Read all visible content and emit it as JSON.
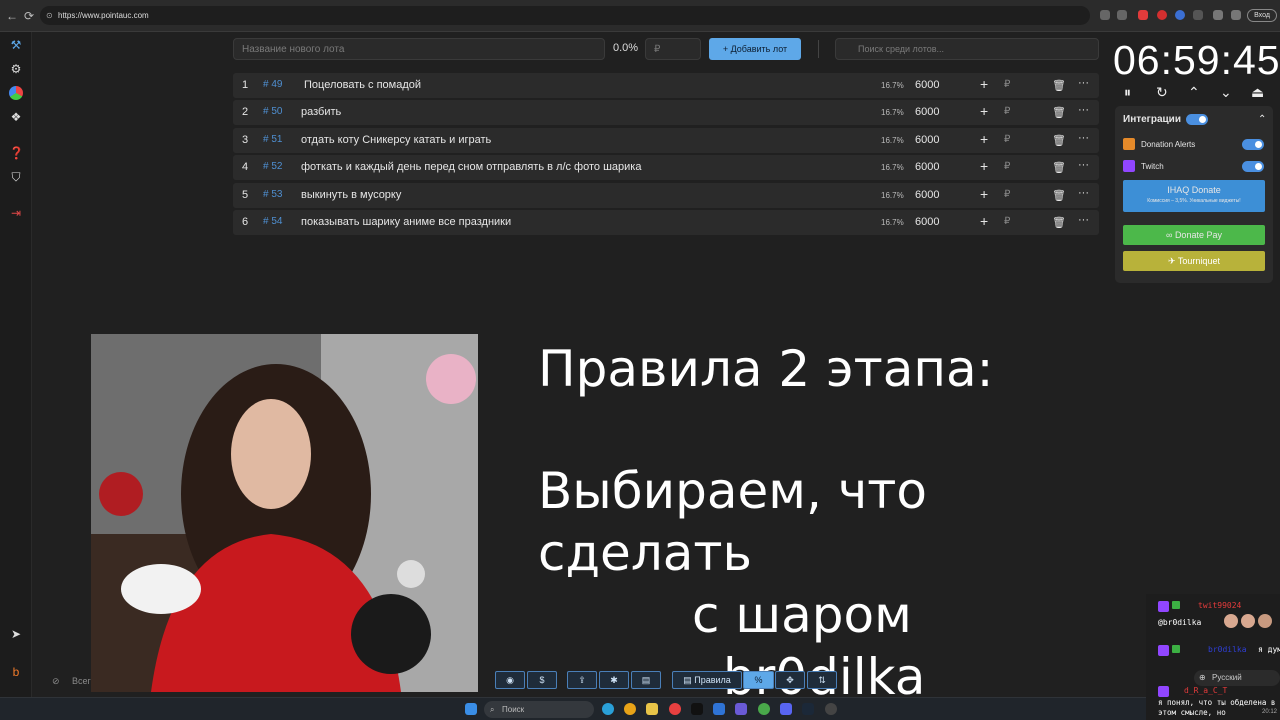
{
  "browser": {
    "url": "https://www.pointauc.com",
    "profile_label": "Вход",
    "back": "←",
    "reload": "⟳"
  },
  "sidebar": {
    "icons": [
      "auction-icon",
      "settings-icon",
      "wheel-icon",
      "layers-icon",
      "help-icon",
      "shield-icon",
      "logout-icon",
      "telegram-icon",
      "boosty-icon"
    ]
  },
  "form": {
    "lot_name_placeholder": "Название нового лота",
    "percent": "0.0%",
    "amount_placeholder": "₽",
    "add_label": "Добавить лот",
    "search_placeholder": "Поиск среди лотов..."
  },
  "lots": [
    {
      "index": "1",
      "id": "# 49",
      "name": "Поцеловать с помадой",
      "percent": "16.7%",
      "amount": "6000"
    },
    {
      "index": "2",
      "id": "# 50",
      "name": "разбить",
      "percent": "16.7%",
      "amount": "6000"
    },
    {
      "index": "3",
      "id": "# 51",
      "name": "отдать коту Сникерсу катать и играть",
      "percent": "16.7%",
      "amount": "6000"
    },
    {
      "index": "4",
      "id": "# 52",
      "name": "фоткать и каждый день перед сном отправлять в л/с фото шарика",
      "percent": "16.7%",
      "amount": "6000"
    },
    {
      "index": "5",
      "id": "# 53",
      "name": "выкинуть в мусорку",
      "percent": "16.7%",
      "amount": "6000"
    },
    {
      "index": "6",
      "id": "# 54",
      "name": "показывать шарику аниме все праздники",
      "percent": "16.7%",
      "amount": "6000"
    }
  ],
  "lot_actions": {
    "plus": "+",
    "currency": "₽",
    "trash": "🗑",
    "more": "···"
  },
  "timer": {
    "value": "06:59:45",
    "controls": [
      "⏸",
      "↻",
      "⌃",
      "⌄",
      "⏏"
    ]
  },
  "integrations": {
    "title": "Интеграции",
    "collapse": "⌃",
    "items": [
      {
        "label": "Donation Alerts",
        "color": "#e58a2a"
      },
      {
        "label": "Twitch",
        "color": "#9146ff"
      }
    ],
    "ihaq": {
      "label": "IHAQ Donate",
      "sub": "Комиссия – 3,5%. Уникальные виджеты!",
      "color": "#3d8fd6"
    },
    "donatepay": {
      "label": "Donate Pay",
      "color": "#4cb84a"
    },
    "tourniquet": {
      "label": "Tourniquet",
      "color": "#b8b23a"
    }
  },
  "rules": {
    "line1": "Правила 2 этапа:",
    "line2": "Выбираем, что сделать",
    "line3": "с  шаром",
    "line4": "br0dilka"
  },
  "toolbar": {
    "rules_label": "Правила",
    "percent_label": "%",
    "hidden_label": "Всег"
  },
  "chat": {
    "messages": [
      {
        "user": "twit99024",
        "text": "@br0dilka",
        "user_color": "#e43b3b"
      },
      {
        "user": "br0dilka",
        "text": "я думаю",
        "user_color": "#2f3fd6"
      },
      {
        "user": "d_R_a_C_T",
        "text": "я понял, что ты обделена в этом смысле, но",
        "user_color": "#e43b3b"
      }
    ],
    "language": "Русский"
  },
  "taskbar": {
    "search_placeholder": "Поиск",
    "time": "20:12"
  }
}
